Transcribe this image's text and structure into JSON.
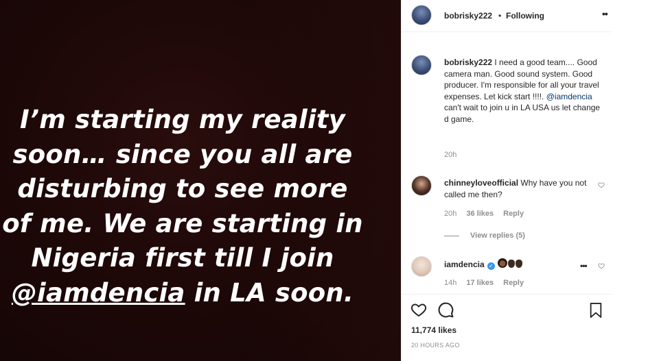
{
  "story": {
    "lines": [
      "I’m starting my reality",
      "soon… since you all are",
      "disturbing to see more",
      "of me. We are starting in",
      "Nigeria first till I join"
    ],
    "last_line_mention": "@iamdencia",
    "last_line_rest": " in LA soon."
  },
  "header": {
    "username": "bobrisky222",
    "dot": "•",
    "follow_status": "Following",
    "more_label": "••"
  },
  "caption": {
    "username": "bobrisky222",
    "text": " I need a good team.... Good camera man. Good sound system. Good producer. I'm responsible for all your travel expenses. Let kick start !!!!. ",
    "mention": "@iamdencia",
    "text_after": " can't wait to join u in LA USA us let change d game.",
    "time": "20h"
  },
  "comments": [
    {
      "username": "chinneyloveofficial",
      "text": " Why have you not called me then?",
      "time": "20h",
      "likes": "36 likes",
      "reply": "Reply",
      "view_replies": "View replies (5)"
    },
    {
      "username": "iamdencia",
      "verified": "✓",
      "time": "14h",
      "likes": "17 likes",
      "reply": "Reply",
      "more_label": "•••"
    }
  ],
  "footer": {
    "likes": "11,774 likes",
    "posted": "20 HOURS AGO"
  },
  "icons": [
    "heart-icon",
    "comment-icon",
    "bookmark-icon",
    "more-icon",
    "verified-icon"
  ]
}
